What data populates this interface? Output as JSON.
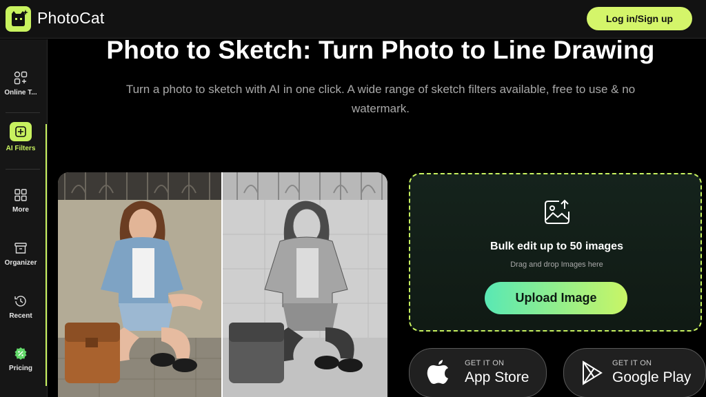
{
  "header": {
    "app_name": "PhotoCat",
    "login_label": "Log in/Sign up"
  },
  "sidebar": {
    "items": [
      {
        "label": "Online T...",
        "icon": "tools-grid-icon"
      },
      {
        "label": "AI Filters",
        "icon": "ai-filters-icon"
      },
      {
        "label": "More",
        "icon": "grid-icon"
      },
      {
        "label": "Organizer",
        "icon": "archive-box-icon"
      },
      {
        "label": "Recent",
        "icon": "history-icon"
      },
      {
        "label": "Pricing",
        "icon": "pricing-badge-icon"
      }
    ]
  },
  "main": {
    "title": "Photo to Sketch: Turn Photo to Line Drawing",
    "subtitle_line1": "Turn a photo to sketch with AI in one click. A wide range of sketch filters available, free to use & no",
    "subtitle_line2": "watermark."
  },
  "upload": {
    "heading": "Bulk edit up to 50 images",
    "hint": "Drag and drop Images here",
    "button_label": "Upload Image"
  },
  "stores": {
    "appstore_small": "GET IT ON",
    "appstore_big": "App Store",
    "google_small": "GET IT ON",
    "google_big": "Google Play"
  },
  "colors": {
    "accent": "#c8f25f",
    "background": "#000000",
    "sidebar": "#161616"
  }
}
